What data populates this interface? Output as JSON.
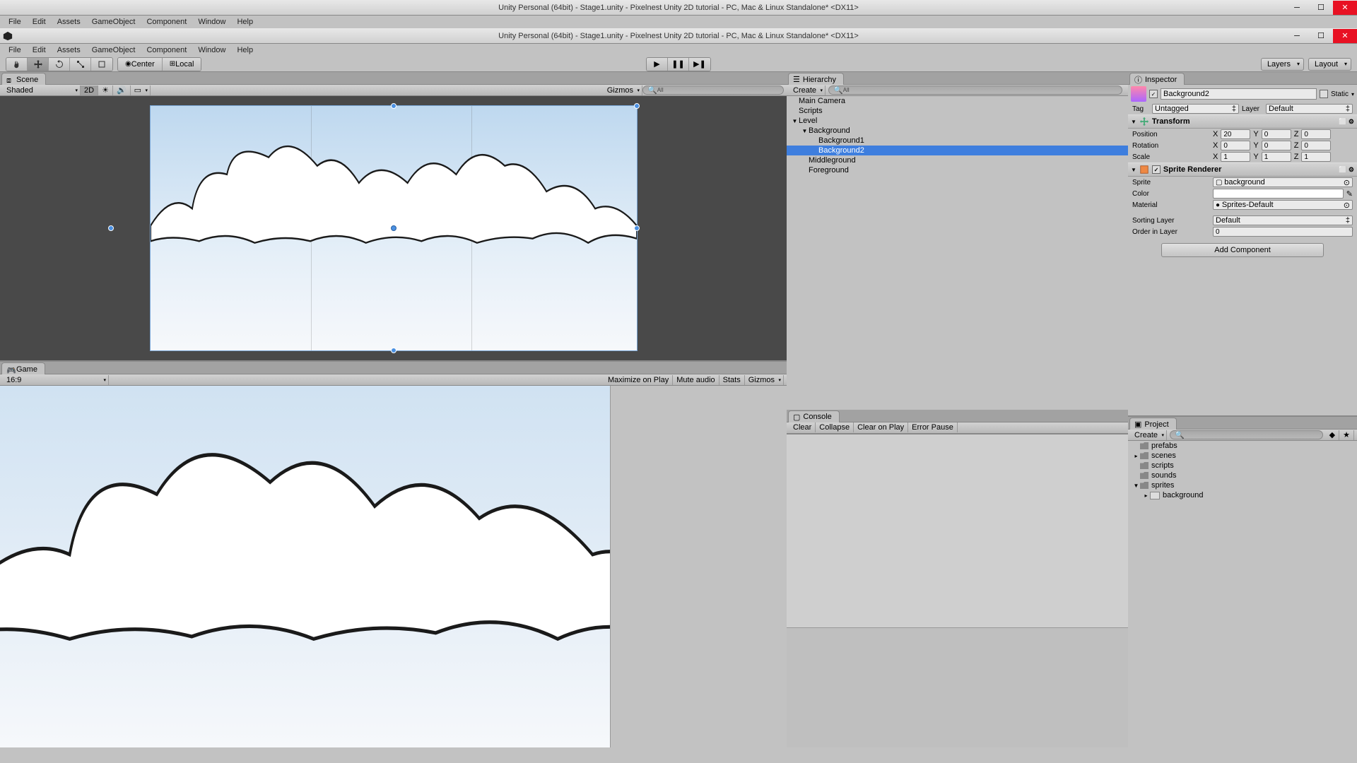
{
  "title": "Unity Personal (64bit) - Stage1.unity - Pixelnest Unity 2D tutorial - PC, Mac & Linux Standalone* <DX11>",
  "menus": [
    "File",
    "Edit",
    "Assets",
    "GameObject",
    "Component",
    "Window",
    "Help"
  ],
  "toolbar": {
    "pivot": "Center",
    "space": "Local",
    "layers": "Layers",
    "layout": "Layout"
  },
  "scene": {
    "tab": "Scene",
    "shading": "Shaded",
    "mode2d": "2D",
    "gizmos": "Gizmos",
    "searchAll": "All"
  },
  "game": {
    "tab": "Game",
    "aspect": "16:9",
    "maxOnPlay": "Maximize on Play",
    "muteAudio": "Mute audio",
    "stats": "Stats",
    "gizmos": "Gizmos"
  },
  "hierarchy": {
    "tab": "Hierarchy",
    "create": "Create",
    "searchAll": "All",
    "items": [
      {
        "name": "Main Camera",
        "indent": 0
      },
      {
        "name": "Scripts",
        "indent": 0
      },
      {
        "name": "Level",
        "indent": 0,
        "arrow": "▼"
      },
      {
        "name": "Background",
        "indent": 1,
        "arrow": "▼"
      },
      {
        "name": "Background1",
        "indent": 2
      },
      {
        "name": "Background2",
        "indent": 2,
        "selected": true
      },
      {
        "name": "Middleground",
        "indent": 1
      },
      {
        "name": "Foreground",
        "indent": 1
      }
    ]
  },
  "console": {
    "tab": "Console",
    "clear": "Clear",
    "collapse": "Collapse",
    "clearOnPlay": "Clear on Play",
    "errorPause": "Error Pause"
  },
  "inspector": {
    "tab": "Inspector",
    "objectName": "Background2",
    "static": "Static",
    "tagLabel": "Tag",
    "tagValue": "Untagged",
    "layerLabel": "Layer",
    "layerValue": "Default",
    "transform": {
      "title": "Transform",
      "position": {
        "label": "Position",
        "x": "20",
        "y": "0",
        "z": "0"
      },
      "rotation": {
        "label": "Rotation",
        "x": "0",
        "y": "0",
        "z": "0"
      },
      "scale": {
        "label": "Scale",
        "x": "1",
        "y": "1",
        "z": "1"
      }
    },
    "spriteRenderer": {
      "title": "Sprite Renderer",
      "sprite": {
        "label": "Sprite",
        "value": "background"
      },
      "color": {
        "label": "Color"
      },
      "material": {
        "label": "Material",
        "value": "Sprites-Default"
      },
      "sortingLayer": {
        "label": "Sorting Layer",
        "value": "Default"
      },
      "orderInLayer": {
        "label": "Order in Layer",
        "value": "0"
      }
    },
    "addComponent": "Add Component"
  },
  "project": {
    "tab": "Project",
    "create": "Create",
    "folders": [
      {
        "name": "prefabs",
        "indent": 0
      },
      {
        "name": "scenes",
        "indent": 0,
        "arrow": "▸"
      },
      {
        "name": "scripts",
        "indent": 0
      },
      {
        "name": "sounds",
        "indent": 0
      },
      {
        "name": "sprites",
        "indent": 0,
        "arrow": "▼"
      },
      {
        "name": "background",
        "indent": 1,
        "file": true,
        "arrow": "▸"
      }
    ]
  },
  "axisLabels": {
    "x": "X",
    "y": "Y",
    "z": "Z"
  }
}
